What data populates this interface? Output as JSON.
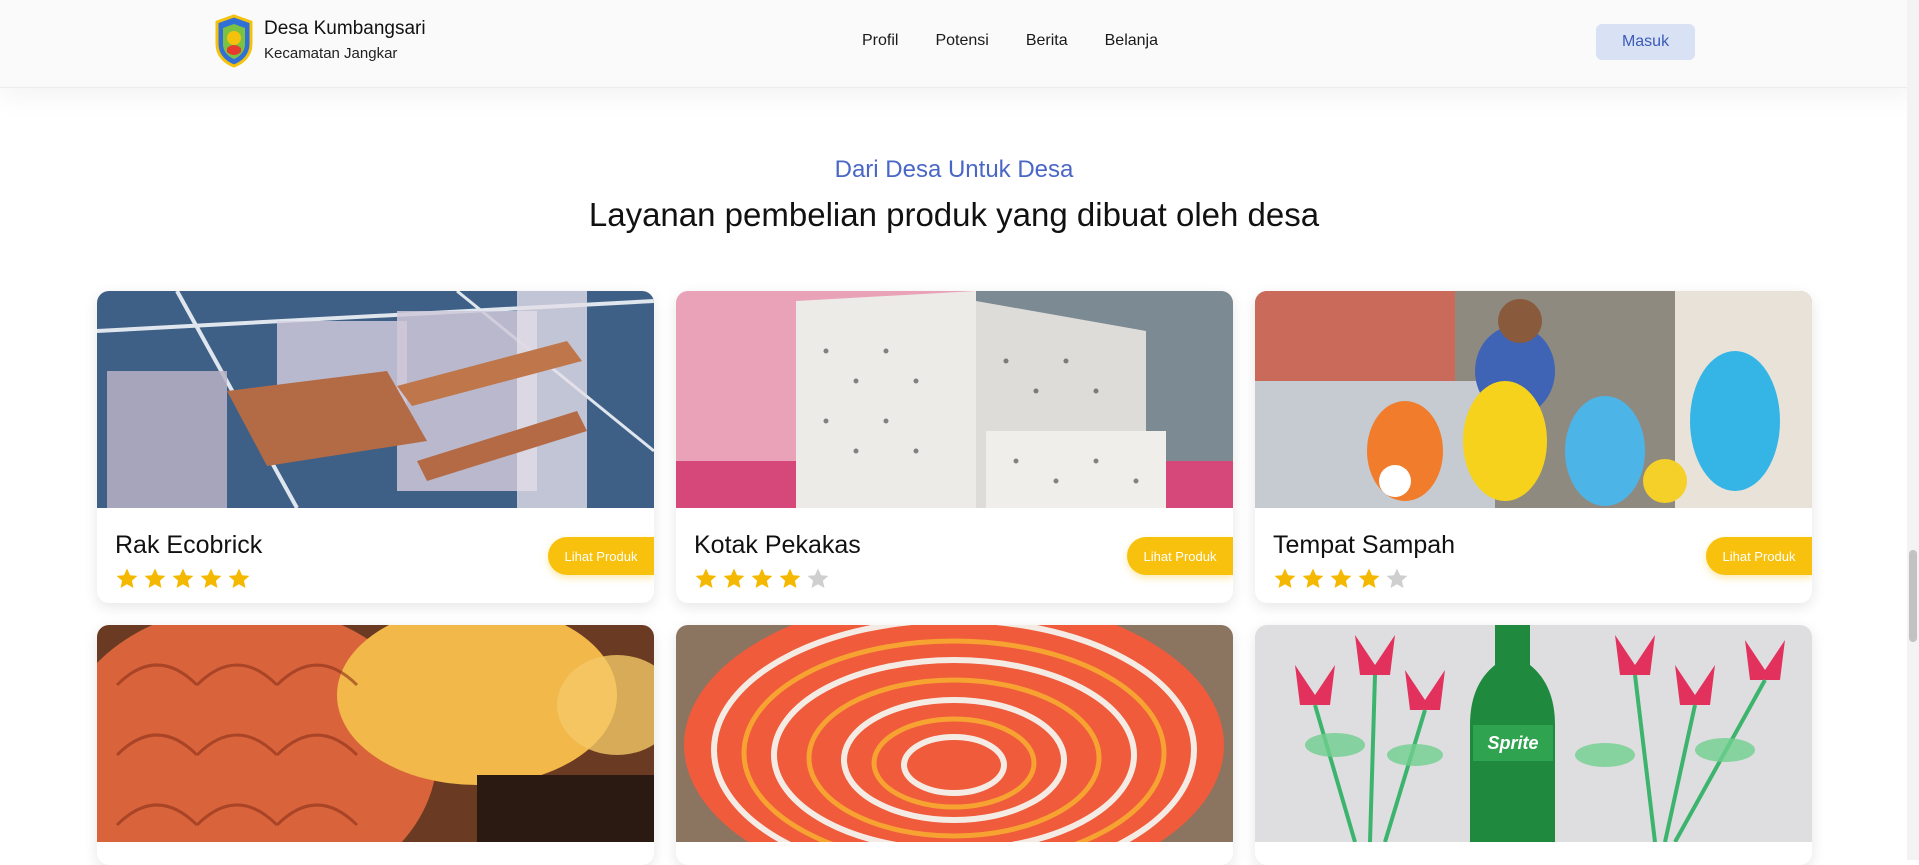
{
  "header": {
    "brand_name": "Desa Kumbangsari",
    "brand_sub": "Kecamatan Jangkar",
    "nav": [
      "Profil",
      "Potensi",
      "Berita",
      "Belanja"
    ],
    "login_label": "Masuk"
  },
  "section": {
    "kicker": "Dari Desa Untuk Desa",
    "heading": "Layanan pembelian produk yang dibuat oleh desa"
  },
  "products": [
    {
      "title": "Rak Ecobrick",
      "rating": 5,
      "button": "Lihat Produk"
    },
    {
      "title": "Kotak Pekakas",
      "rating": 4,
      "button": "Lihat Produk"
    },
    {
      "title": "Tempat Sampah",
      "rating": 4,
      "button": "Lihat Produk"
    }
  ],
  "bottom_products_images": [
    "shell-lamp-image",
    "woven-bowl-image",
    "bottle-flowers-image"
  ],
  "bottle_label": "Sprite",
  "colors": {
    "accent_blue": "#4a67c6",
    "button_yellow": "#f8c10e",
    "star_gold": "#f5b800",
    "star_gray": "#cfcfcf"
  }
}
